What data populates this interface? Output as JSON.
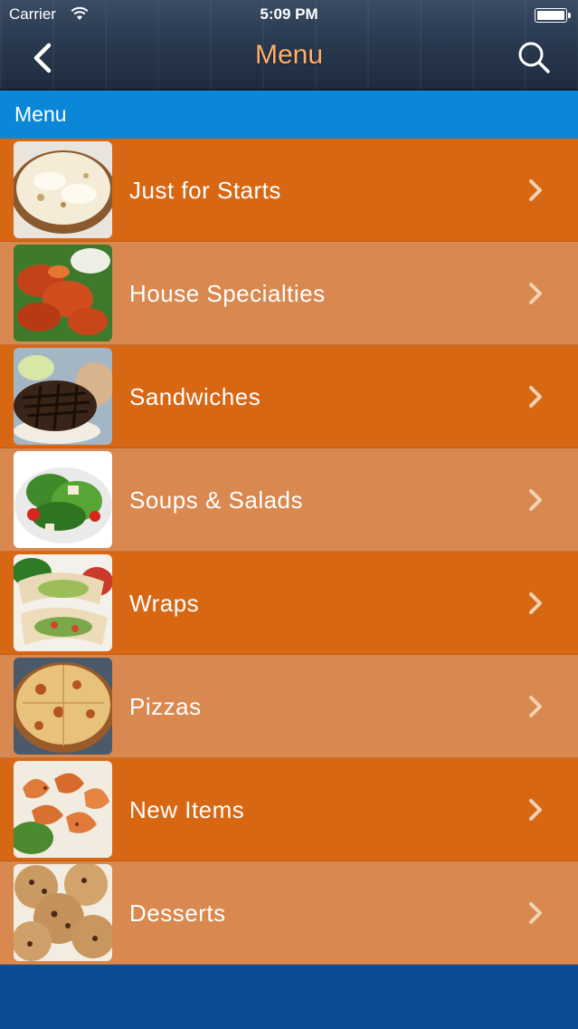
{
  "status_bar": {
    "carrier": "Carrier",
    "time": "5:09 PM"
  },
  "nav": {
    "title": "Menu",
    "back_icon": "chevron-left-icon",
    "search_icon": "search-icon"
  },
  "section": {
    "title": "Menu"
  },
  "colors": {
    "section_blue": "#0a87d6",
    "row_dark": "#d86714",
    "row_light": "#d9884f",
    "footer_blue": "#0b4d92",
    "title_orange": "#ffb06a"
  },
  "menu_items": [
    {
      "label": "Just for Starts",
      "image": "cheese-pizza-bread-photo"
    },
    {
      "label": "House Specialties",
      "image": "buffalo-wings-photo"
    },
    {
      "label": "Sandwiches",
      "image": "burger-patty-photo"
    },
    {
      "label": "Soups & Salads",
      "image": "garden-salad-photo"
    },
    {
      "label": "Wraps",
      "image": "wraps-photo"
    },
    {
      "label": "Pizzas",
      "image": "pizza-photo"
    },
    {
      "label": "New Items",
      "image": "shrimp-photo"
    },
    {
      "label": "Desserts",
      "image": "cookies-photo"
    }
  ]
}
